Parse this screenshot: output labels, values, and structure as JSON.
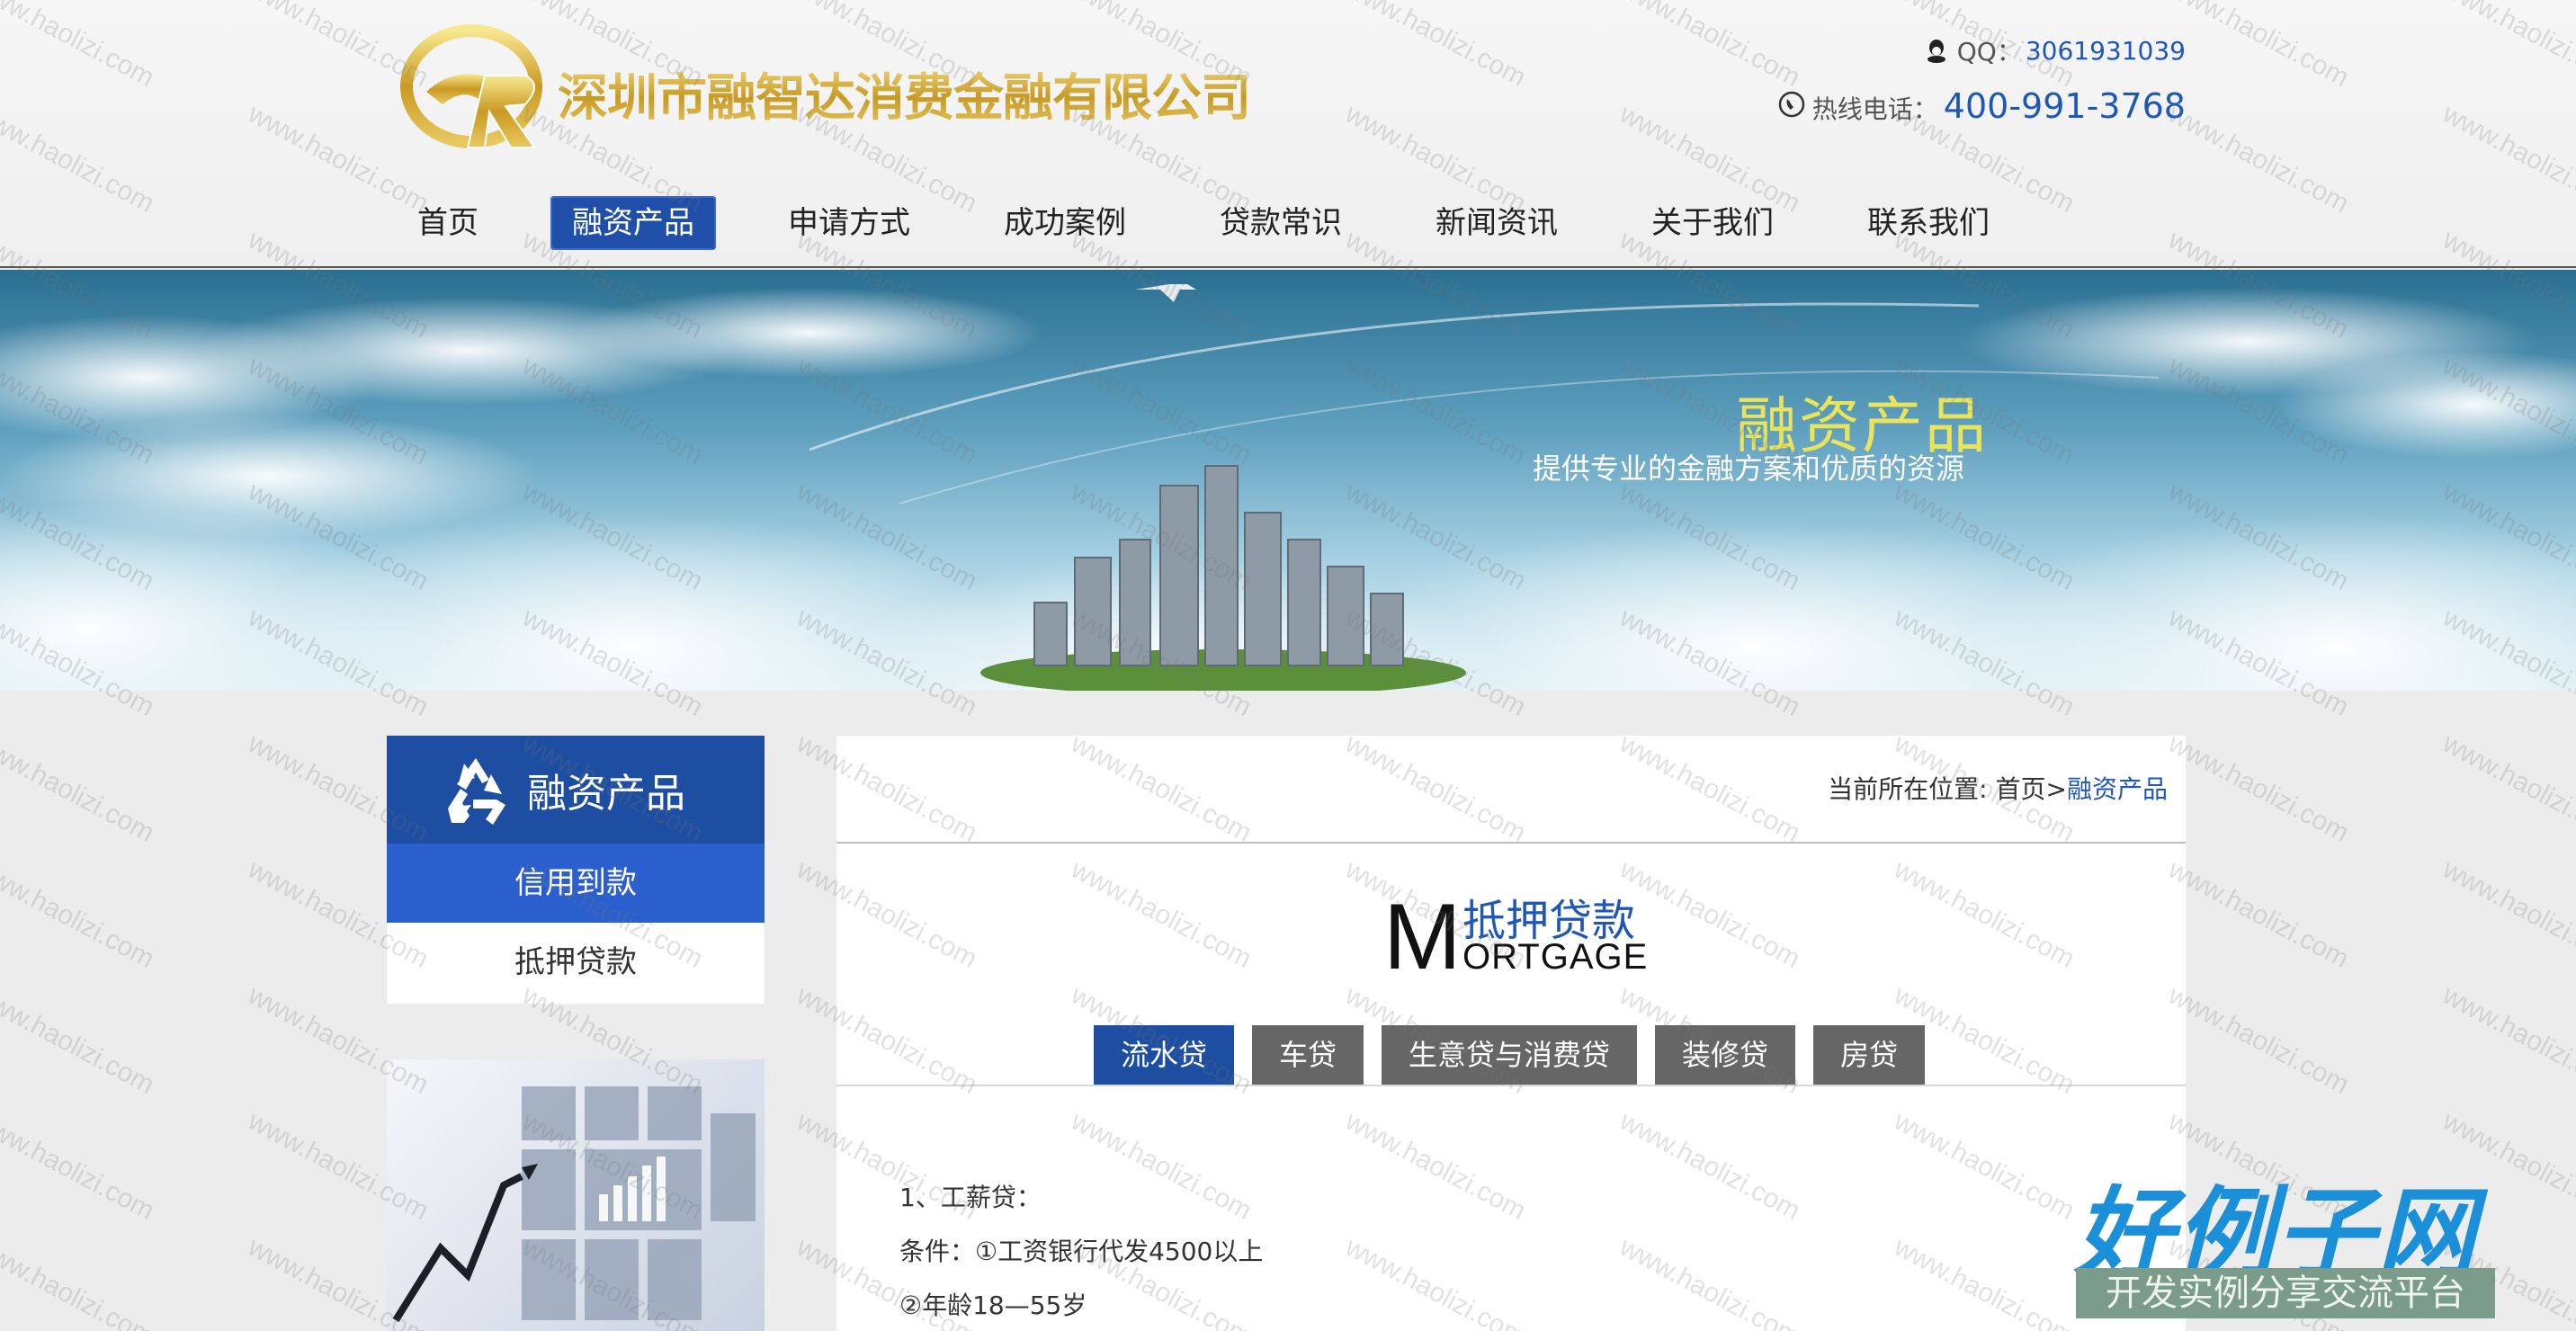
{
  "header": {
    "company_name": "深圳市融智达消费金融有限公司",
    "qq_label": "QQ：",
    "qq_value": "3061931039",
    "hotline_label": "热线电话：",
    "hotline_value": "400-991-3768"
  },
  "nav": {
    "items": [
      {
        "label": "首页"
      },
      {
        "label": "融资产品",
        "active": true
      },
      {
        "label": "申请方式"
      },
      {
        "label": "成功案例"
      },
      {
        "label": "贷款常识"
      },
      {
        "label": "新闻资讯"
      },
      {
        "label": "关于我们"
      },
      {
        "label": "联系我们"
      }
    ]
  },
  "banner": {
    "title": "融资产品",
    "subtitle": "提供专业的金融方案和优质的资源"
  },
  "sidebar": {
    "title": "融资产品",
    "items": [
      {
        "label": "信用到款",
        "active": true
      },
      {
        "label": "抵押贷款"
      }
    ]
  },
  "breadcrumb": {
    "prefix": "当前所在位置: ",
    "home": "首页",
    "separator": ">",
    "current": "融资产品"
  },
  "section": {
    "m_letter": "M",
    "title_cn": "抵押贷款",
    "title_en": "ORTGAGE"
  },
  "tabs": [
    {
      "label": "流水贷",
      "active": true
    },
    {
      "label": "车贷"
    },
    {
      "label": "生意贷与消费贷"
    },
    {
      "label": "装修贷"
    },
    {
      "label": "房贷"
    }
  ],
  "content": {
    "lines": [
      "1、工薪贷：",
      "条件：①工资银行代发4500以上",
      "②年龄18—55岁"
    ]
  },
  "badge": {
    "title": "好例子网",
    "subtitle": "开发实例分享交流平台"
  },
  "watermark": {
    "text": "www.haolizi.com"
  },
  "colors": {
    "brand_blue": "#1e4ea2",
    "link_blue": "#1f57b8",
    "tab_gray": "#666666",
    "gold": "#d8b446"
  }
}
